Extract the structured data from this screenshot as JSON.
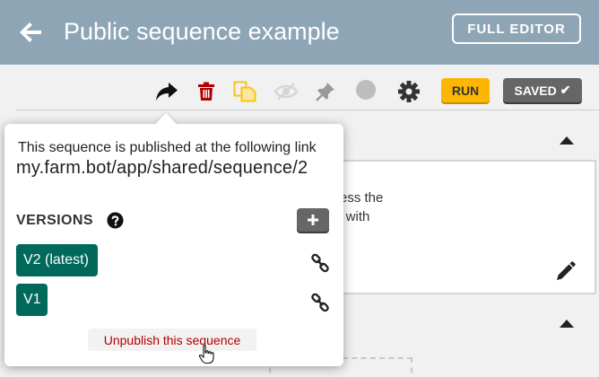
{
  "header": {
    "title": "Public sequence example",
    "full_editor_label": "FULL EDITOR",
    "back_icon": "arrow-left-icon"
  },
  "toolbar": {
    "run_label": "RUN",
    "saved_label": "SAVED",
    "saved_check": "✔",
    "icons": [
      "share-icon",
      "trash-icon",
      "copy-icon",
      "eye-slash-icon",
      "pin-icon",
      "color-dot-icon",
      "gear-icon"
    ]
  },
  "step": {
    "text_line1": "ress the",
    "text_line2": "it with"
  },
  "popover": {
    "published_text": "This sequence is published at the following link",
    "link": "my.farm.bot/app/shared/sequence/2",
    "versions_label": "VERSIONS",
    "add_label": "+",
    "versions": [
      {
        "label": "V2 (latest)"
      },
      {
        "label": "V1"
      }
    ],
    "unpublish_label": "Unpublish this sequence"
  },
  "colors": {
    "header_bg": "#8ea5b6",
    "run_yellow": "#fdb702",
    "saved_gray": "#666666",
    "version_teal": "#00695c",
    "trash_red": "#b00000",
    "copy_yellow": "#f5c518",
    "unpublish_red": "#b30000"
  }
}
